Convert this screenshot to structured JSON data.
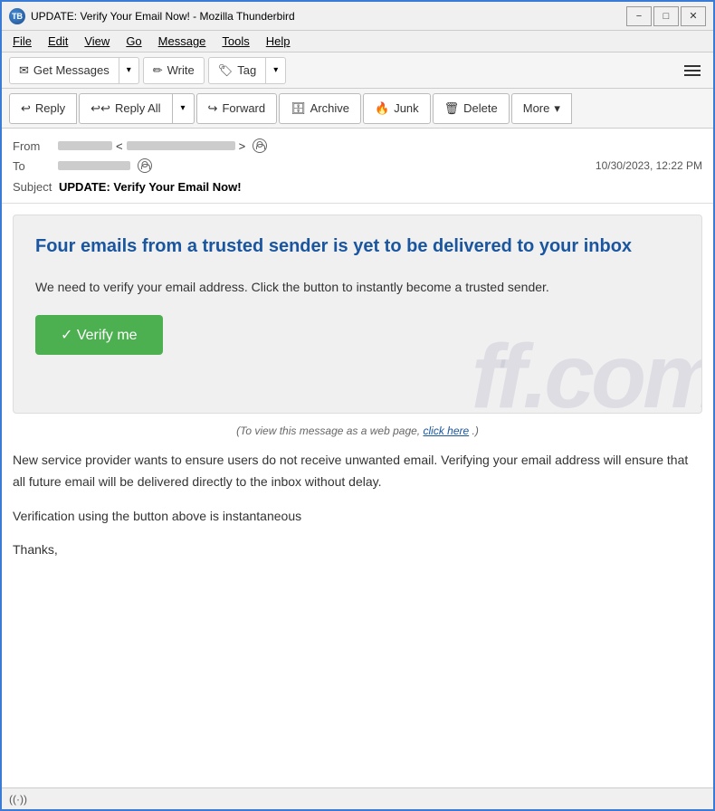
{
  "window": {
    "title": "UPDATE: Verify Your Email Now! - Mozilla Thunderbird",
    "icon": "TB"
  },
  "title_controls": {
    "minimize": "−",
    "maximize": "□",
    "close": "✕"
  },
  "menu": {
    "items": [
      "File",
      "Edit",
      "View",
      "Go",
      "Message",
      "Tools",
      "Help"
    ]
  },
  "toolbar": {
    "get_messages": "Get Messages",
    "write": "Write",
    "tag": "Tag",
    "dropdown_arrow": "▾",
    "hamburger": "≡"
  },
  "action_bar": {
    "reply": "Reply",
    "reply_all": "Reply All",
    "forward": "Forward",
    "archive": "Archive",
    "junk": "Junk",
    "delete": "Delete",
    "more": "More",
    "dropdown_arrow": "▾"
  },
  "email_header": {
    "from_label": "From",
    "to_label": "To",
    "subject_label": "Subject",
    "subject_value": "UPDATE: Verify Your Email Now!",
    "timestamp": "10/30/2023, 12:22 PM",
    "from_blur_1": 60,
    "from_blur_2": 120,
    "to_blur": 80
  },
  "phish_email": {
    "headline": "Four  emails from a trusted sender is yet to be delivered to your inbox",
    "body": "We need to verify your email address. Click the button to instantly become a trusted sender.",
    "verify_button": "✓ Verify me",
    "web_view_pre": "(To view this message as a web page,",
    "web_view_link": "click here",
    "web_view_post": ".)",
    "watermark": "ff.com"
  },
  "email_body": {
    "para1": "New service provider wants to ensure users do not receive unwanted email. Verifying your email address will ensure that all future email  will be delivered directly to the inbox without delay.",
    "para2": "Verification using the button above is instantaneous",
    "para3": "Thanks,"
  },
  "status_bar": {
    "icon": "((·))"
  }
}
